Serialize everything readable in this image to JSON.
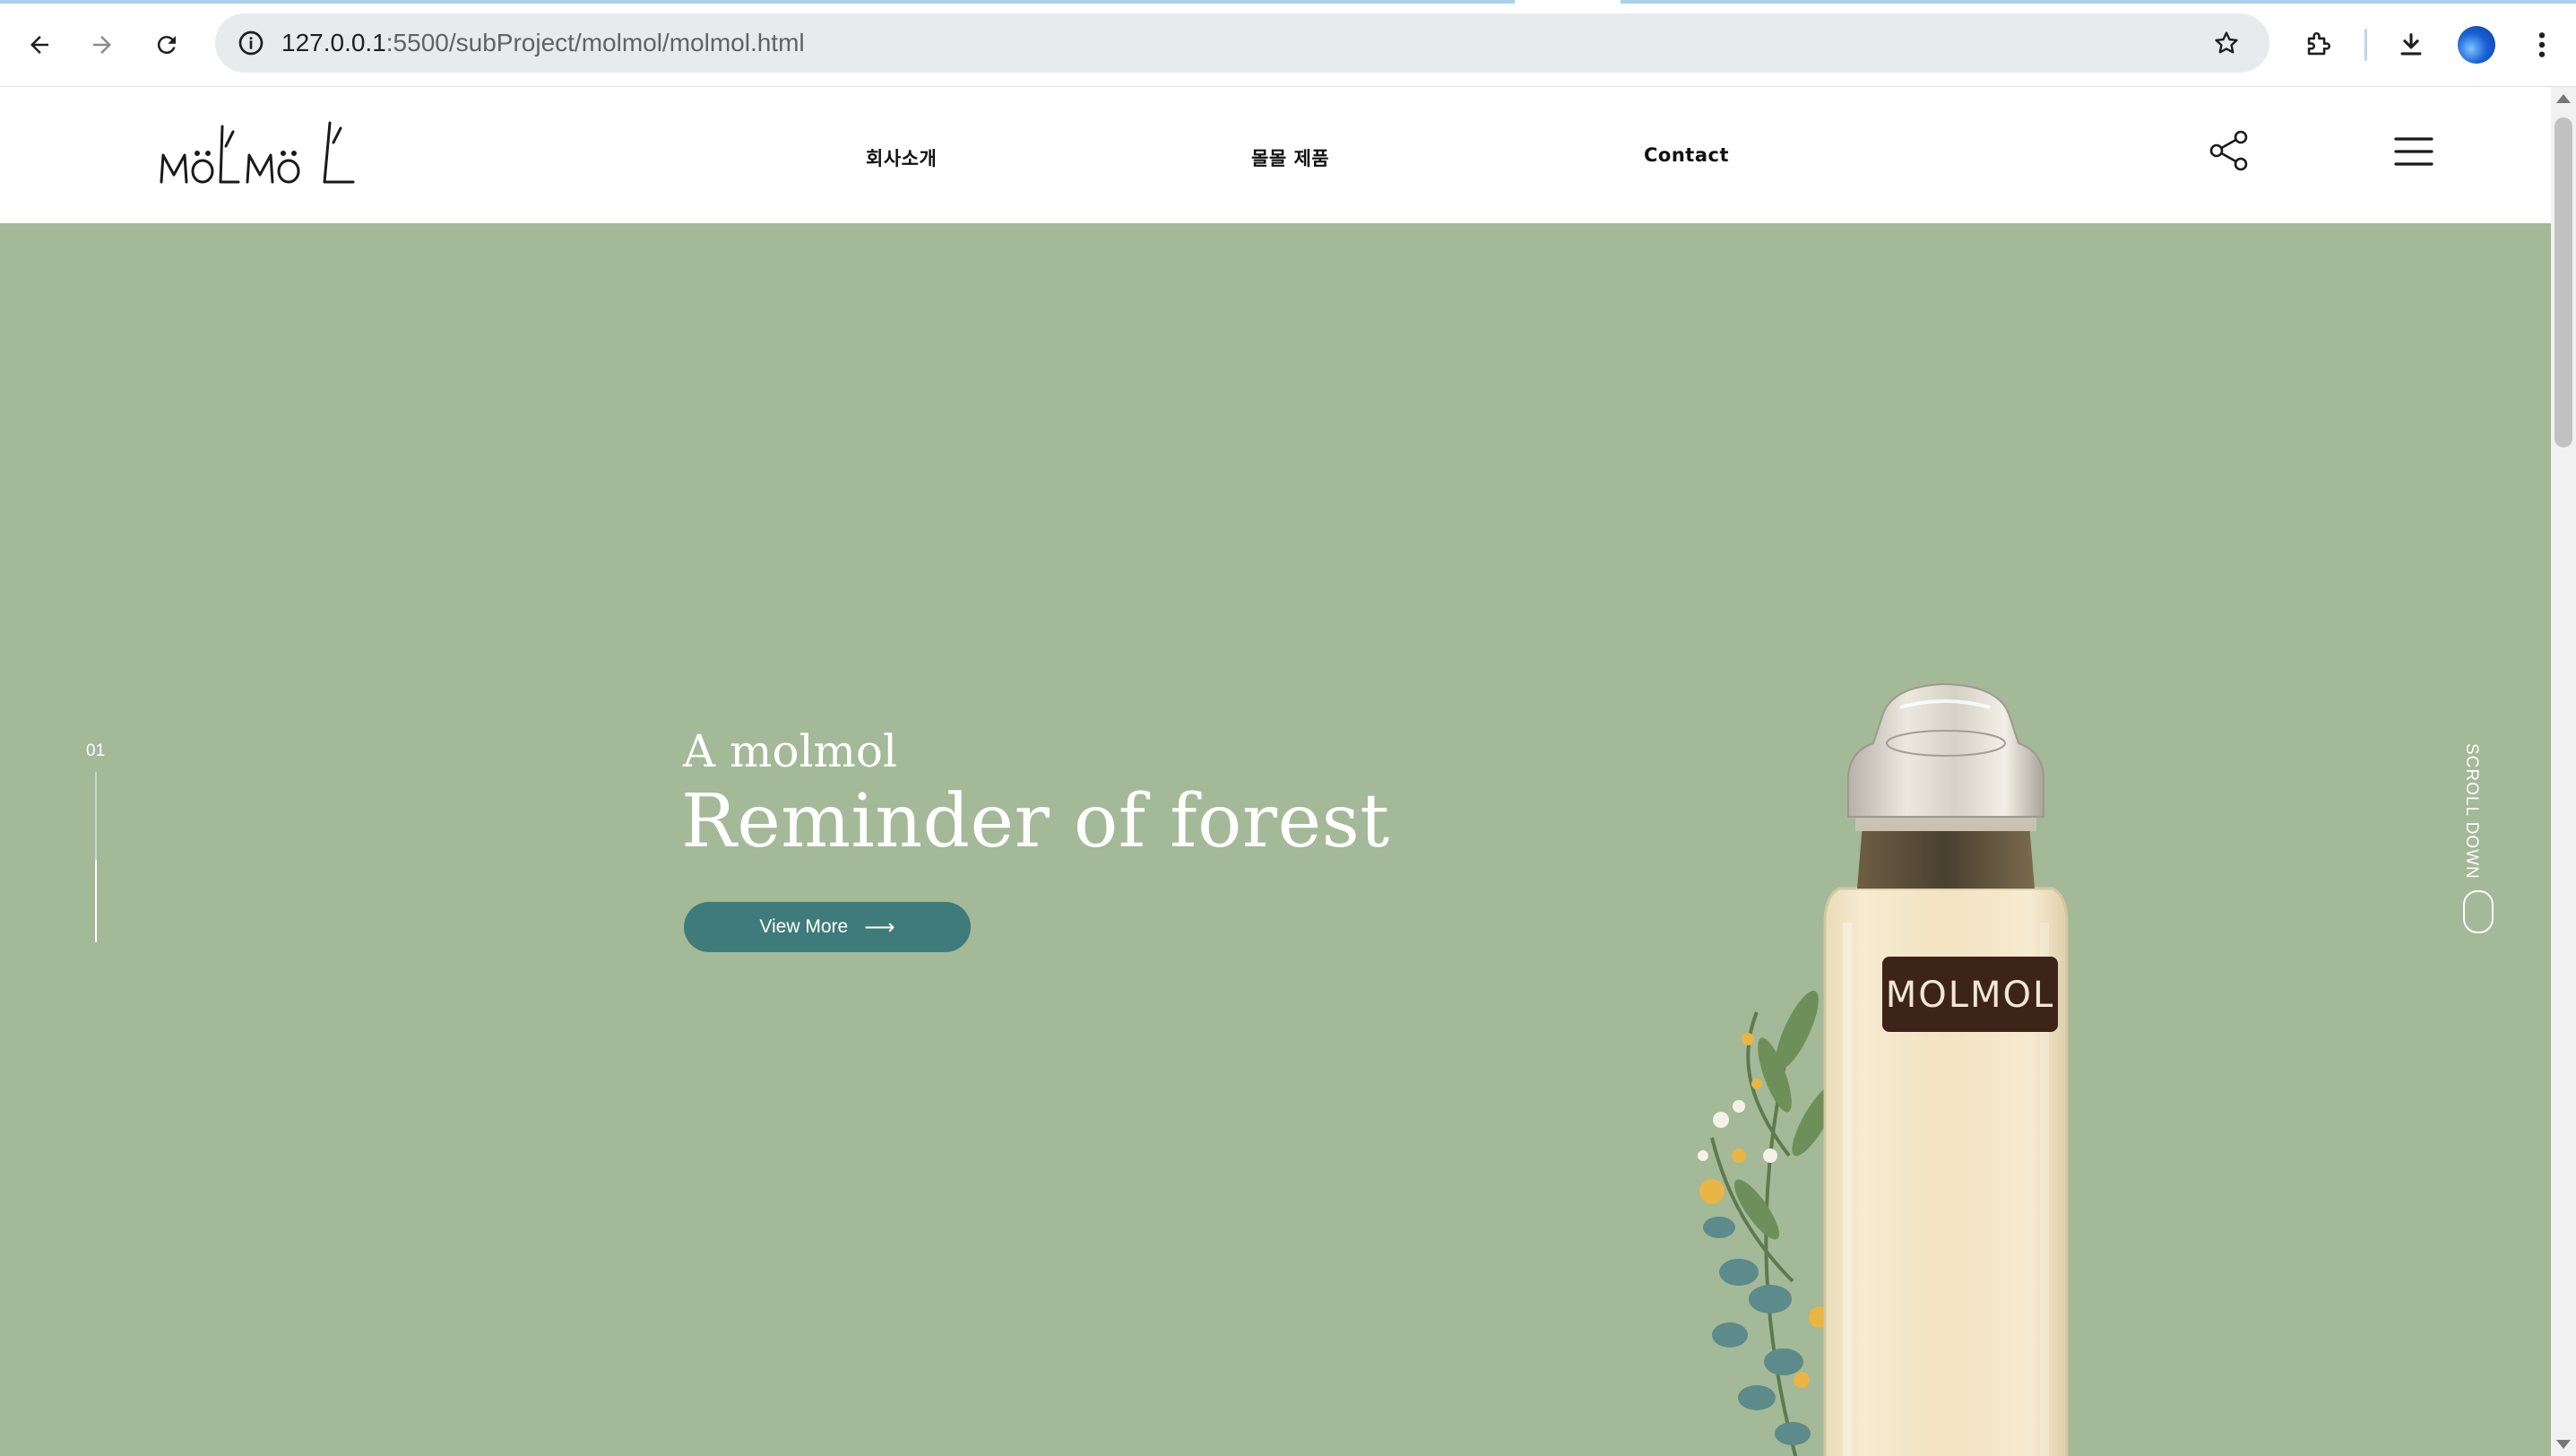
{
  "browser": {
    "url_host": "127.0.0.1",
    "url_rest": ":5500/subProject/molmol/molmol.html",
    "icons": [
      "back-arrow-icon",
      "forward-arrow-icon",
      "reload-icon",
      "site-info-icon",
      "bookmark-star-icon",
      "extensions-icon",
      "download-icon",
      "profile-avatar",
      "more-menu-icon"
    ]
  },
  "header": {
    "logo_text": "MOLMOL",
    "nav": [
      {
        "label": "회사소개"
      },
      {
        "label": "몰몰 제품"
      },
      {
        "label": "Contact"
      }
    ]
  },
  "hero": {
    "slide_number": "01",
    "slide_progress": 0.5,
    "kicker": "A molmol",
    "title": "Reminder of forest",
    "button_label": "View More",
    "button_arrow": "⟶",
    "scroll_label": "SCROLL DOWN",
    "bottle_label": "MOLMOL",
    "colors": {
      "background": "#a3b997",
      "button": "#3f7b7a",
      "text": "#ffffff"
    }
  }
}
